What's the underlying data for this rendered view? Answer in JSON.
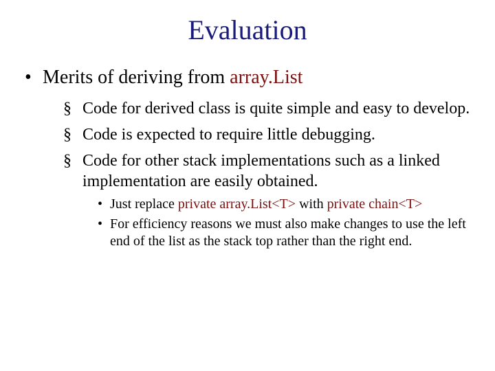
{
  "title": "Evaluation",
  "l1": {
    "pre": "Merits of deriving from ",
    "accent": "array.List"
  },
  "l2a": "Code for derived class is quite simple and easy to develop.",
  "l2b": "Code is expected to require little debugging.",
  "l2c": "Code for other stack implementations such as a linked implementation are easily obtained.",
  "l3a": {
    "t1": "Just replace ",
    "a1": "private array.List<T>",
    "t2": " with ",
    "a2": "private chain<T>"
  },
  "l3b": "For efficiency reasons we must also make changes to use the left end of the list as the stack top rather than the right end."
}
